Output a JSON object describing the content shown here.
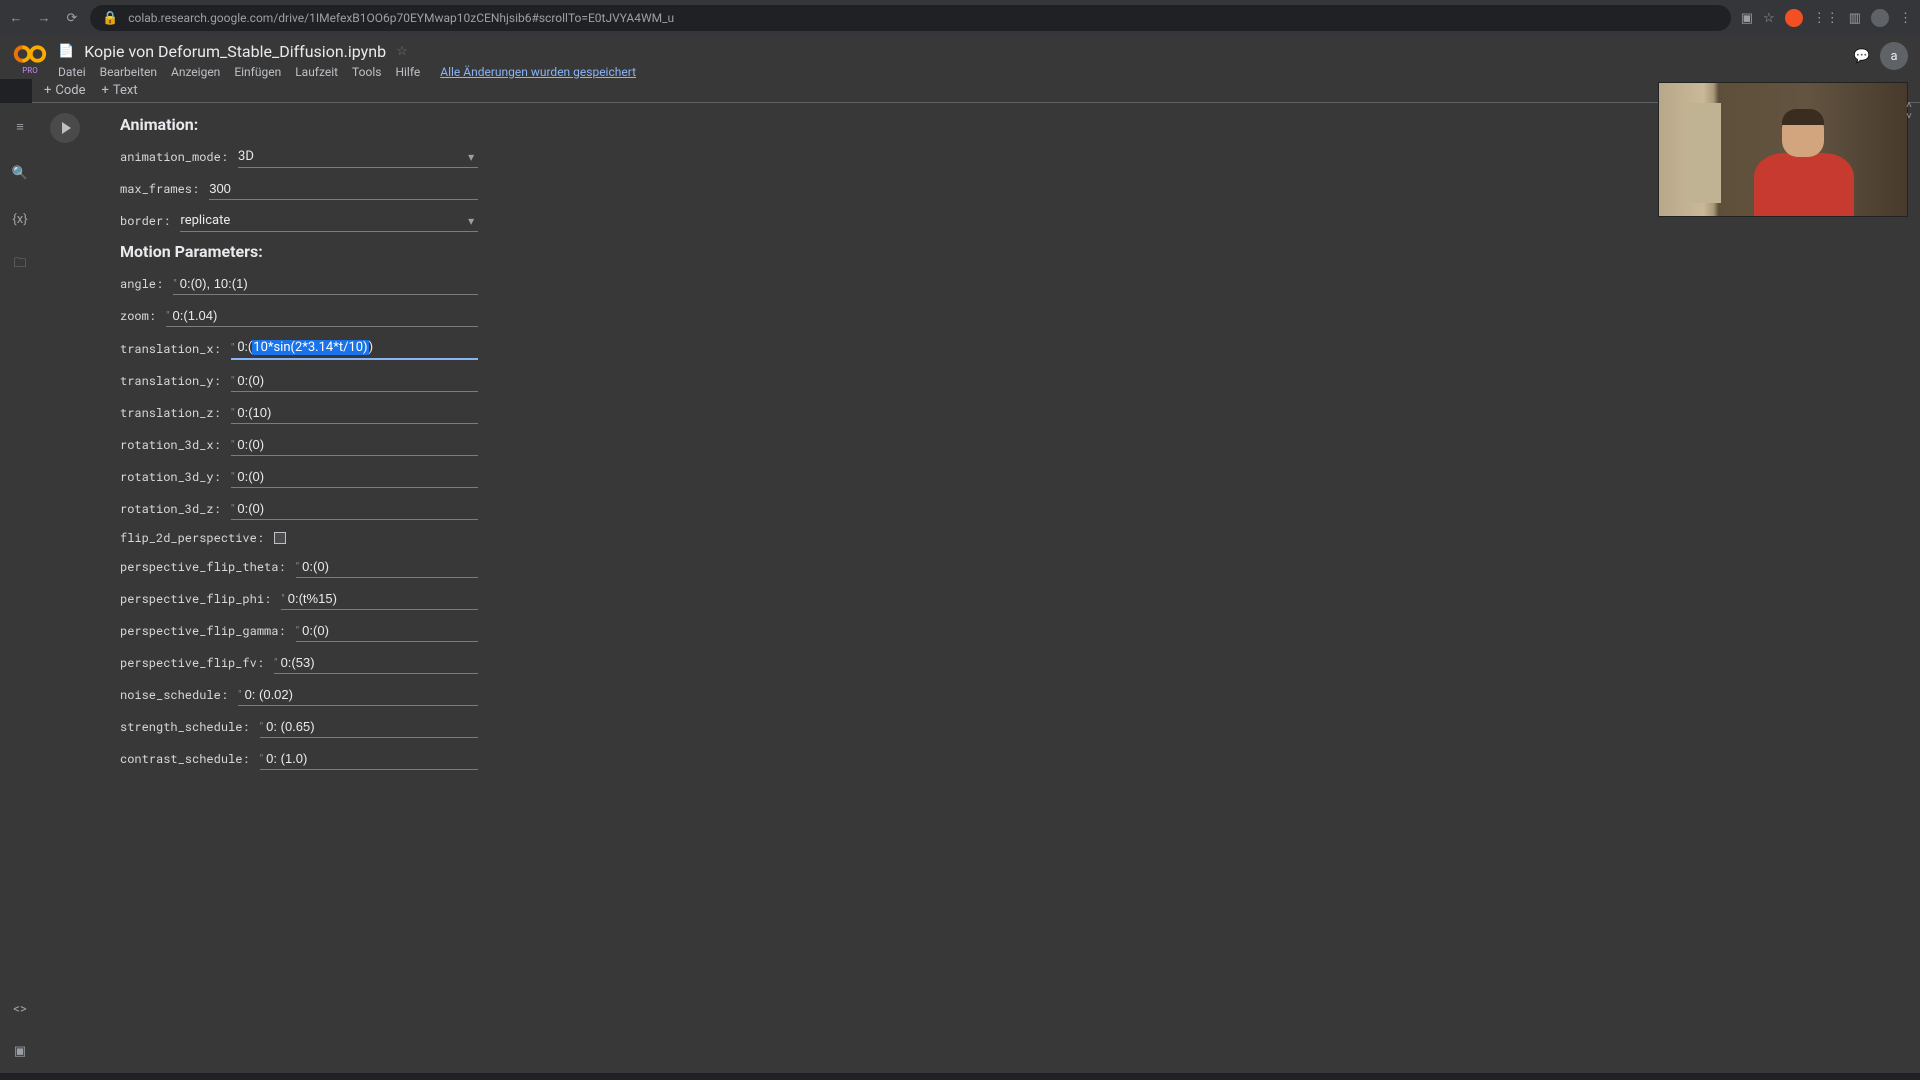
{
  "browser": {
    "url": "colab.research.google.com/drive/1IMefexB1OO6p70EYMwap10zCENhjsib6#scrollTo=E0tJVYA4WM_u"
  },
  "header": {
    "filename": "Kopie von Deforum_Stable_Diffusion.ipynb",
    "pro": "PRO",
    "menus": {
      "file": "Datei",
      "edit": "Bearbeiten",
      "view": "Anzeigen",
      "insert": "Einfügen",
      "runtime": "Laufzeit",
      "tools": "Tools",
      "help": "Hilfe"
    },
    "save_status": "Alle Änderungen wurden gespeichert",
    "avatar": "a"
  },
  "toolbar": {
    "code": "Code",
    "text": "Text"
  },
  "sections": {
    "animation": "Animation:",
    "motion": "Motion Parameters:"
  },
  "params": {
    "animation_mode": {
      "label": "animation_mode:",
      "value": "3D"
    },
    "max_frames": {
      "label": "max_frames:",
      "value": "300"
    },
    "border": {
      "label": "border:",
      "value": "replicate"
    },
    "angle": {
      "label": "angle:",
      "value": "0:(0), 10:(1)"
    },
    "zoom": {
      "label": "zoom:",
      "value": "0:(1.04)"
    },
    "translation_x": {
      "label": "translation_x:",
      "prefix": "0:(",
      "highlight": "10*sin(2*3.14*t/10)",
      "suffix": ")"
    },
    "translation_y": {
      "label": "translation_y:",
      "value": "0:(0)"
    },
    "translation_z": {
      "label": "translation_z:",
      "value": "0:(10)"
    },
    "rotation_3d_x": {
      "label": "rotation_3d_x:",
      "value": "0:(0)"
    },
    "rotation_3d_y": {
      "label": "rotation_3d_y:",
      "value": "0:(0)"
    },
    "rotation_3d_z": {
      "label": "rotation_3d_z:",
      "value": "0:(0)"
    },
    "flip_2d_perspective": {
      "label": "flip_2d_perspective:"
    },
    "perspective_flip_theta": {
      "label": "perspective_flip_theta:",
      "value": "0:(0)"
    },
    "perspective_flip_phi": {
      "label": "perspective_flip_phi:",
      "value": "0:(t%15)"
    },
    "perspective_flip_gamma": {
      "label": "perspective_flip_gamma:",
      "value": "0:(0)"
    },
    "perspective_flip_fv": {
      "label": "perspective_flip_fv:",
      "value": "0:(53)"
    },
    "noise_schedule": {
      "label": "noise_schedule:",
      "value": "0: (0.02)"
    },
    "strength_schedule": {
      "label": "strength_schedule:",
      "value": "0: (0.65)"
    },
    "contrast_schedule": {
      "label": "contrast_schedule:",
      "value": "0: (1.0)"
    }
  }
}
